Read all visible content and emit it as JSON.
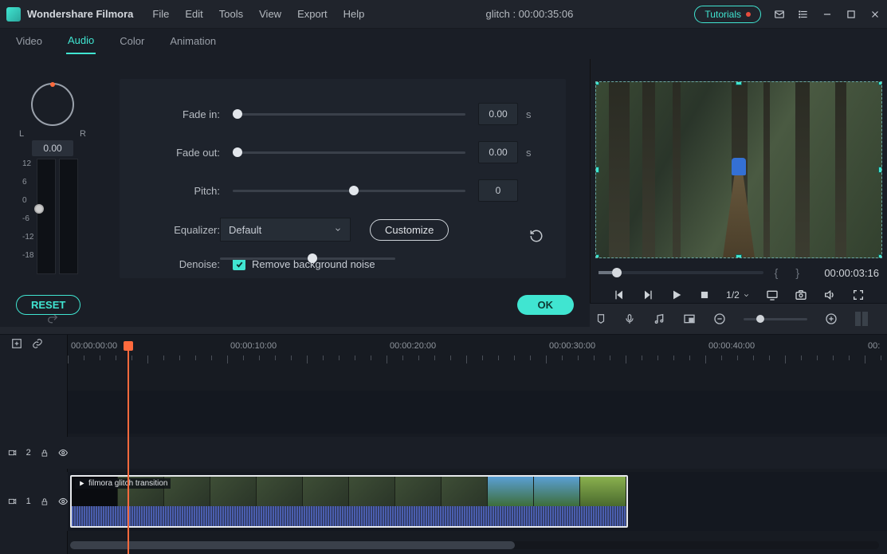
{
  "title": {
    "app": "Wondershare Filmora",
    "project": "glitch : 00:00:35:06",
    "tutorials": "Tutorials"
  },
  "menu": {
    "file": "File",
    "edit": "Edit",
    "tools": "Tools",
    "view": "View",
    "export": "Export",
    "help": "Help"
  },
  "tabs": {
    "video": "Video",
    "audio": "Audio",
    "color": "Color",
    "animation": "Animation"
  },
  "pan": {
    "L": "L",
    "R": "R",
    "value": "0.00"
  },
  "meter": {
    "l12": "12",
    "l6": "6",
    "l0": "0",
    "lm6": "-6",
    "lm12": "-12",
    "lm18": "-18"
  },
  "audio": {
    "fade_in_label": "Fade in:",
    "fade_in_val": "0.00",
    "s1": "s",
    "fade_out_label": "Fade out:",
    "fade_out_val": "0.00",
    "s2": "s",
    "pitch_label": "Pitch:",
    "pitch_val": "0",
    "eq_label": "Equalizer:",
    "eq_value": "Default",
    "customize": "Customize",
    "denoise_label": "Denoise:",
    "denoise_text": "Remove background noise"
  },
  "buttons": {
    "reset": "RESET",
    "ok": "OK"
  },
  "preview": {
    "time": "00:00:03:16",
    "speed": "1/2"
  },
  "ruler": {
    "t0": "00:00:00:00",
    "t10": "00:00:10:00",
    "t20": "00:00:20:00",
    "t30": "00:00:30:00",
    "t40": "00:00:40:00",
    "t50": "00:"
  },
  "tracks": {
    "t2": "2",
    "t1": "1"
  },
  "clip": {
    "label": "filmora glitch transition"
  }
}
